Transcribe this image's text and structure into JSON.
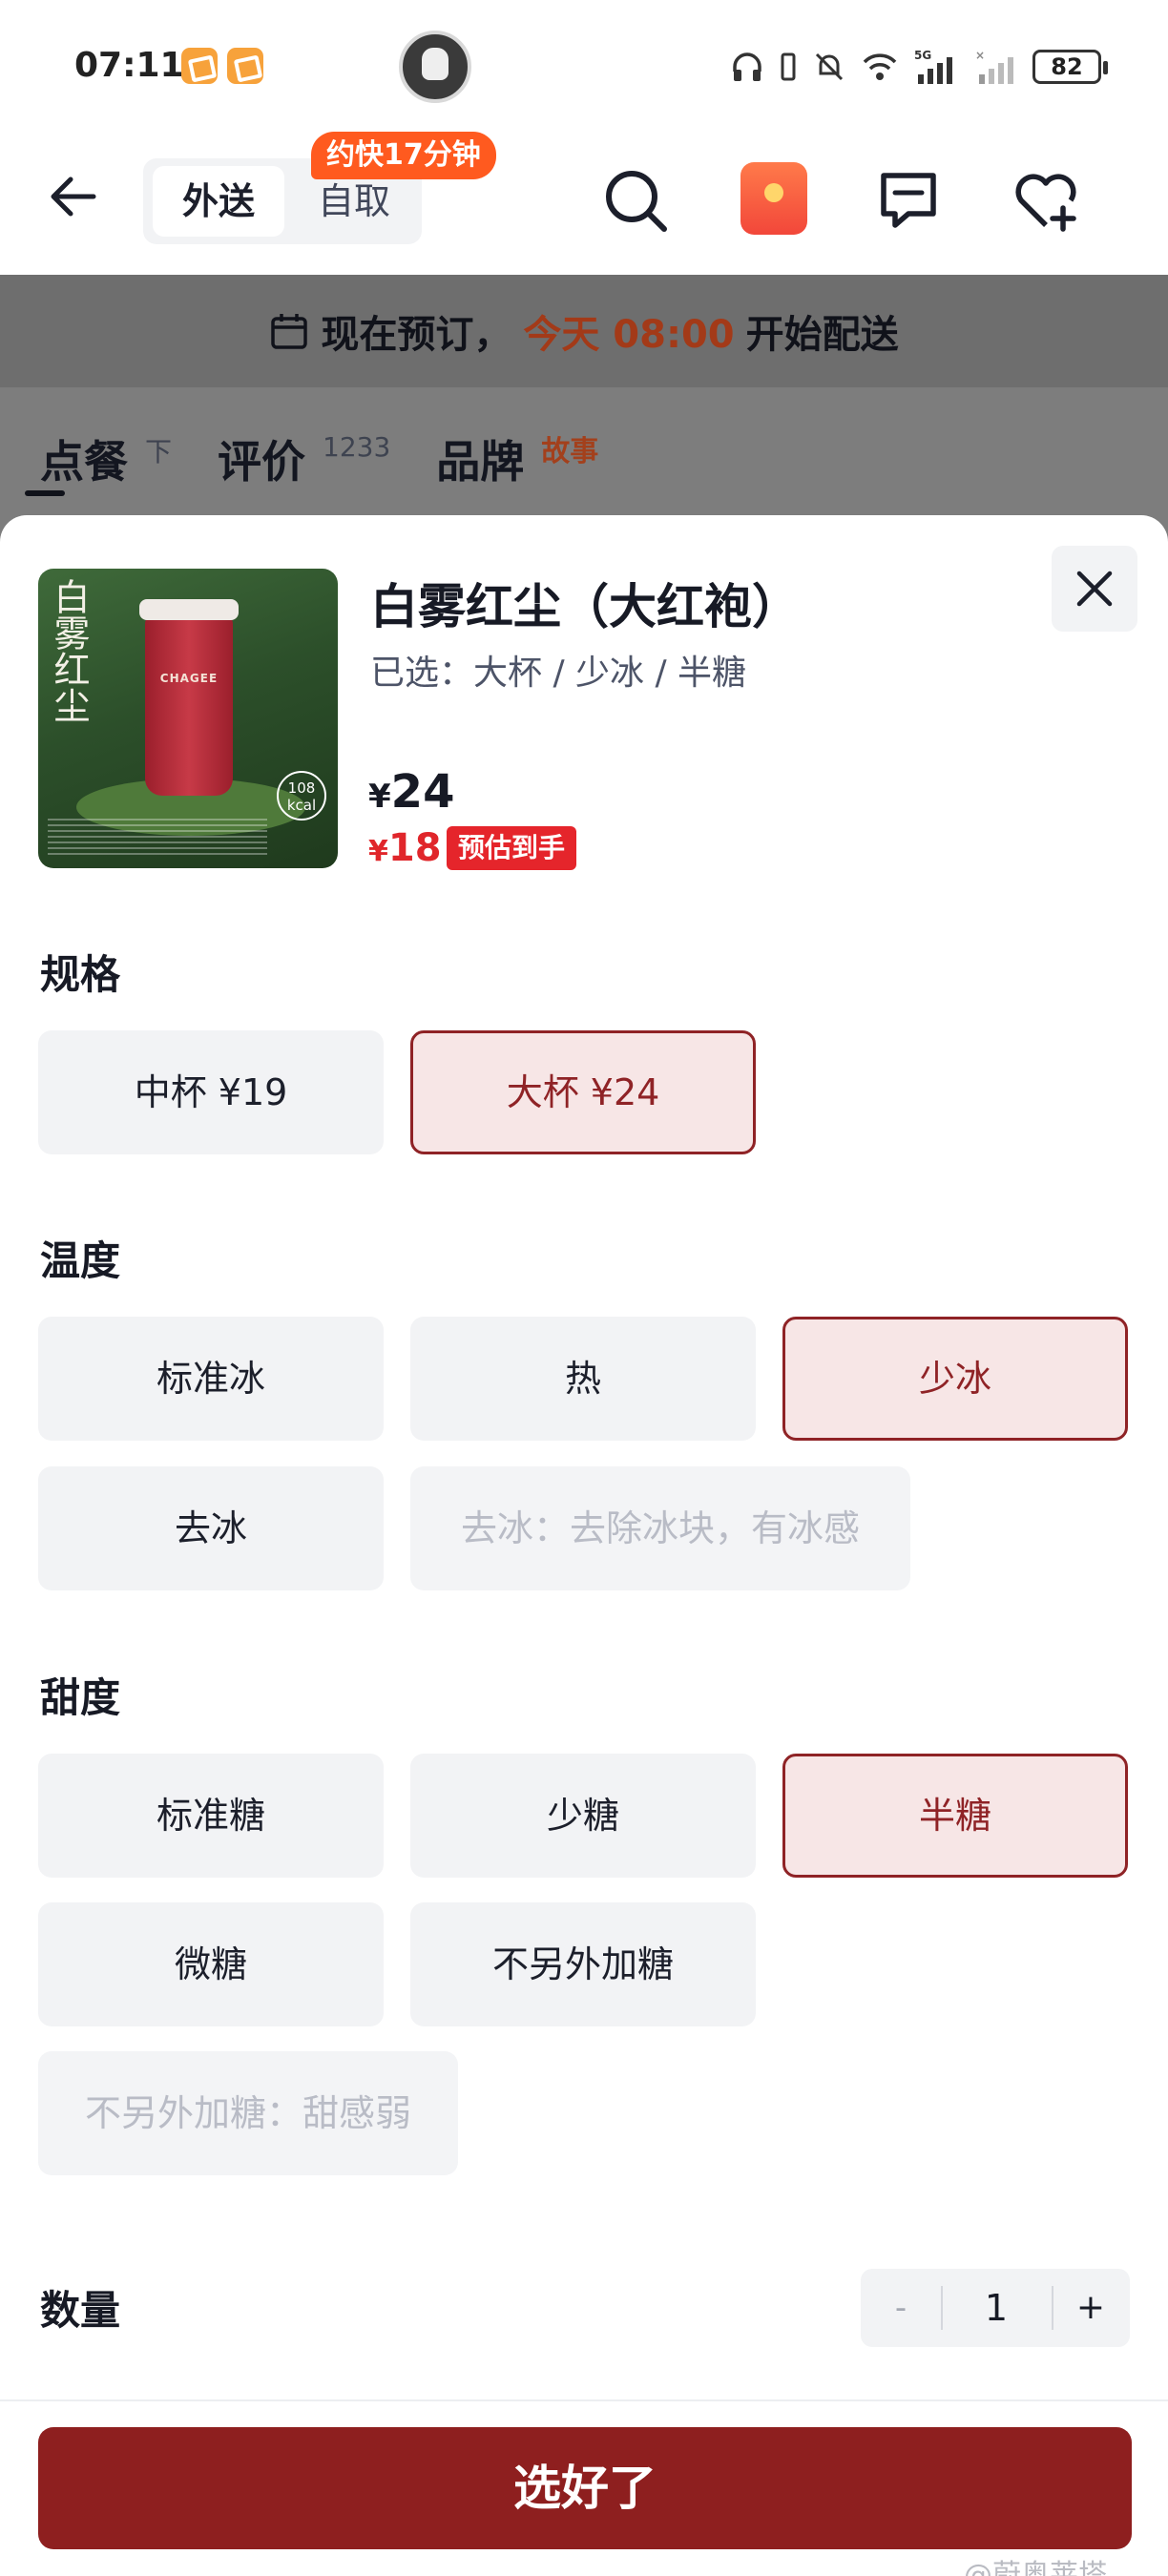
{
  "status_bar": {
    "time": "07:11",
    "battery": "82",
    "network": "5G"
  },
  "header": {
    "tab_delivery": "外送",
    "tab_pickup": "自取",
    "faster_badge": "约快17分钟"
  },
  "notice": {
    "prefix": "现在预订，",
    "highlight": "今天 08:00",
    "suffix": "开始配送"
  },
  "menu_tabs": {
    "order": "点餐",
    "order_sub": "下",
    "reviews": "评价",
    "reviews_count": "1233",
    "brand": "品牌",
    "brand_story": "故事"
  },
  "product": {
    "name": "白雾红尘（大红袍）",
    "selected": "已选：大杯 / 少冰 / 半糖",
    "price_currency": "¥",
    "price": "24",
    "final_currency": "¥",
    "final_price": "18",
    "final_label": "预估到手",
    "image_text": "白雾红尘",
    "image_kcal": "108 kcal",
    "image_brand": "CHAGEE"
  },
  "sections": {
    "size": {
      "title": "规格",
      "options": [
        "中杯 ¥19",
        "大杯 ¥24"
      ],
      "selected_index": 1
    },
    "temperature": {
      "title": "温度",
      "options": [
        "标准冰",
        "热",
        "少冰",
        "去冰"
      ],
      "selected_index": 2,
      "hint": "去冰：去除冰块，有冰感"
    },
    "sweetness": {
      "title": "甜度",
      "options": [
        "标准糖",
        "少糖",
        "半糖",
        "微糖",
        "不另外加糖"
      ],
      "selected_index": 2,
      "hint": "不另外加糖：甜感弱"
    }
  },
  "quantity": {
    "label": "数量",
    "minus": "-",
    "value": "1",
    "plus": "+"
  },
  "confirm_label": "选好了",
  "watermark": "@蔚奥莱塔",
  "colors": {
    "accent": "#8e1f1f",
    "selected_bg": "#f7e6e6",
    "price_red": "#e0262b",
    "badge_orange": "#ff5a1f"
  }
}
